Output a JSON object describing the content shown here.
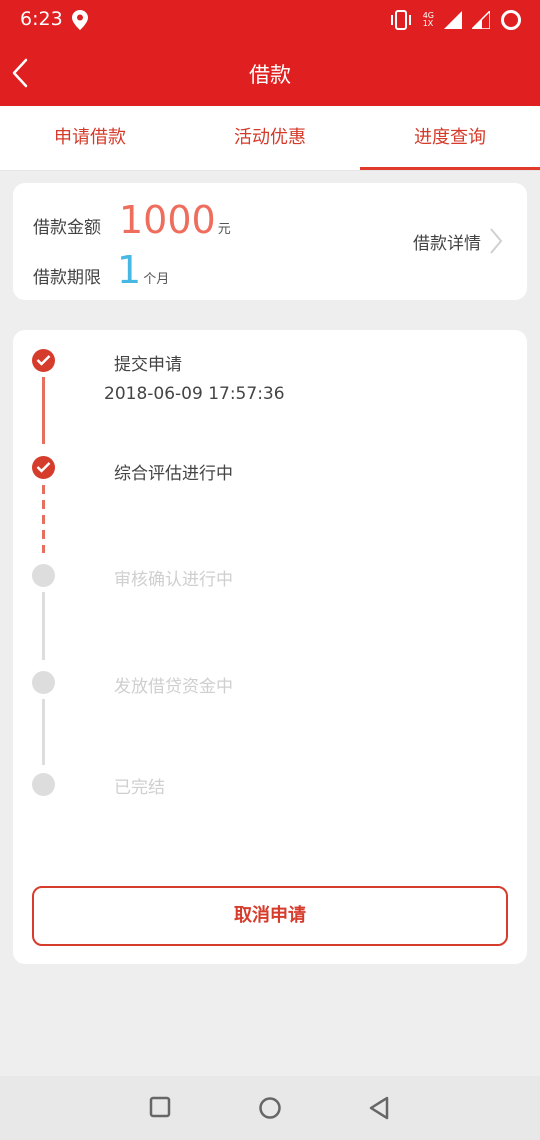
{
  "status_bar": {
    "time": "6:23",
    "network_top": "4G",
    "network_bottom": "1X"
  },
  "header": {
    "title": "借款"
  },
  "tabs": [
    {
      "label": "申请借款",
      "active": false
    },
    {
      "label": "活动优惠",
      "active": false
    },
    {
      "label": "进度查询",
      "active": true
    }
  ],
  "loan": {
    "amount_label": "借款金额",
    "amount_value": "1000",
    "amount_unit": "元",
    "term_label": "借款期限",
    "term_value": "1",
    "term_unit": "个月",
    "detail_link": "借款详情"
  },
  "steps": [
    {
      "label": "提交申请",
      "status": "done",
      "time": "2018-06-09 17:57:36"
    },
    {
      "label": "综合评估进行中",
      "status": "done"
    },
    {
      "label": "审核确认进行中",
      "status": "pending"
    },
    {
      "label": "发放借贷资金中",
      "status": "pending"
    },
    {
      "label": "已完结",
      "status": "pending"
    }
  ],
  "cancel_button": "取消申请",
  "colors": {
    "brand_red": "#e02020",
    "amount_red": "#ef6d5d",
    "term_blue": "#47b7e4"
  }
}
